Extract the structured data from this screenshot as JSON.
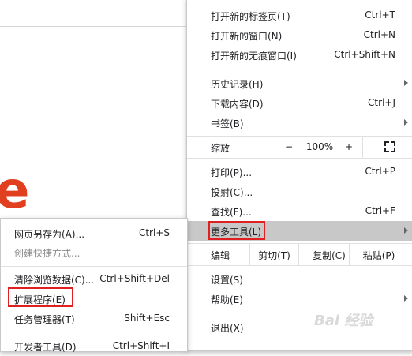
{
  "main_menu": {
    "new_tab": {
      "label": "打开新的标签页(T)",
      "shortcut": "Ctrl+T"
    },
    "new_window": {
      "label": "打开新的窗口(N)",
      "shortcut": "Ctrl+N"
    },
    "new_incognito": {
      "label": "打开新的无痕窗口(I)",
      "shortcut": "Ctrl+Shift+N"
    },
    "history": {
      "label": "历史记录(H)"
    },
    "downloads": {
      "label": "下载内容(D)",
      "shortcut": "Ctrl+J"
    },
    "bookmarks": {
      "label": "书签(B)"
    },
    "zoom": {
      "label": "缩放",
      "minus": "−",
      "value": "100%",
      "plus": "+"
    },
    "print": {
      "label": "打印(P)...",
      "shortcut": "Ctrl+P"
    },
    "cast": {
      "label": "投射(C)..."
    },
    "find": {
      "label": "查找(F)...",
      "shortcut": "Ctrl+F"
    },
    "more_tools": {
      "label": "更多工具(L)"
    },
    "edit": {
      "label": "编辑",
      "cut": "剪切(T)",
      "copy": "复制(C)",
      "paste": "粘贴(P)"
    },
    "settings": {
      "label": "设置(S)"
    },
    "help": {
      "label": "帮助(E)"
    },
    "exit": {
      "label": "退出(X)"
    }
  },
  "sub_menu": {
    "save_page": {
      "label": "网页另存为(A)...",
      "shortcut": "Ctrl+S"
    },
    "create_shortcut": {
      "label": "创建快捷方式..."
    },
    "clear_data": {
      "label": "清除浏览数据(C)...",
      "shortcut": "Ctrl+Shift+Del"
    },
    "extensions": {
      "label": "扩展程序(E)"
    },
    "task_manager": {
      "label": "任务管理器(T)",
      "shortcut": "Shift+Esc"
    },
    "devtools": {
      "label": "开发者工具(D)",
      "shortcut": "Ctrl+Shift+I"
    }
  },
  "background": {
    "partial_letter": "e"
  },
  "colors": {
    "highlight": "#c8c8c8",
    "annotation_red": "#e02020",
    "brand_red": "#e0401f"
  }
}
